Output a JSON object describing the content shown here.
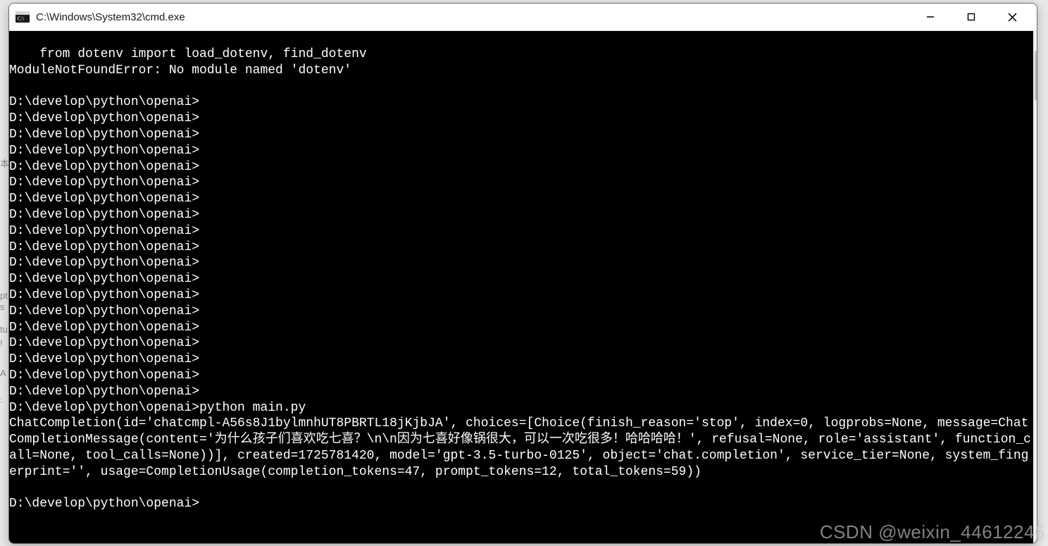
{
  "window": {
    "title": "C:\\Windows\\System32\\cmd.exe"
  },
  "terminal": {
    "lines": [
      "    from dotenv import load_dotenv, find_dotenv",
      "ModuleNotFoundError: No module named 'dotenv'",
      "",
      "D:\\develop\\python\\openai>",
      "D:\\develop\\python\\openai>",
      "D:\\develop\\python\\openai>",
      "D:\\develop\\python\\openai>",
      "D:\\develop\\python\\openai>",
      "D:\\develop\\python\\openai>",
      "D:\\develop\\python\\openai>",
      "D:\\develop\\python\\openai>",
      "D:\\develop\\python\\openai>",
      "D:\\develop\\python\\openai>",
      "D:\\develop\\python\\openai>",
      "D:\\develop\\python\\openai>",
      "D:\\develop\\python\\openai>",
      "D:\\develop\\python\\openai>",
      "D:\\develop\\python\\openai>",
      "D:\\develop\\python\\openai>",
      "D:\\develop\\python\\openai>",
      "D:\\develop\\python\\openai>",
      "D:\\develop\\python\\openai>",
      "D:\\develop\\python\\openai>python main.py",
      "ChatCompletion(id='chatcmpl-A56s8J1bylmnhUT8PBRTL18jKjbJA', choices=[Choice(finish_reason='stop', index=0, logprobs=None, message=ChatCompletionMessage(content='为什么孩子们喜欢吃七喜？\\n\\n因为七喜好像锅很大，可以一次吃很多！哈哈哈哈！', refusal=None, role='assistant', function_call=None, tool_calls=None))], created=1725781420, model='gpt-3.5-turbo-0125', object='chat.completion', service_tier=None, system_fingerprint='', usage=CompletionUsage(completion_tokens=47, prompt_tokens=12, total_tokens=59))",
      "",
      "D:\\develop\\python\\openai>"
    ]
  },
  "watermark": "CSDN @weixin_44612246",
  "left_fragments": [
    "本",
    "pt",
    "s",
    "tu",
    "!",
    "A",
    ":"
  ]
}
